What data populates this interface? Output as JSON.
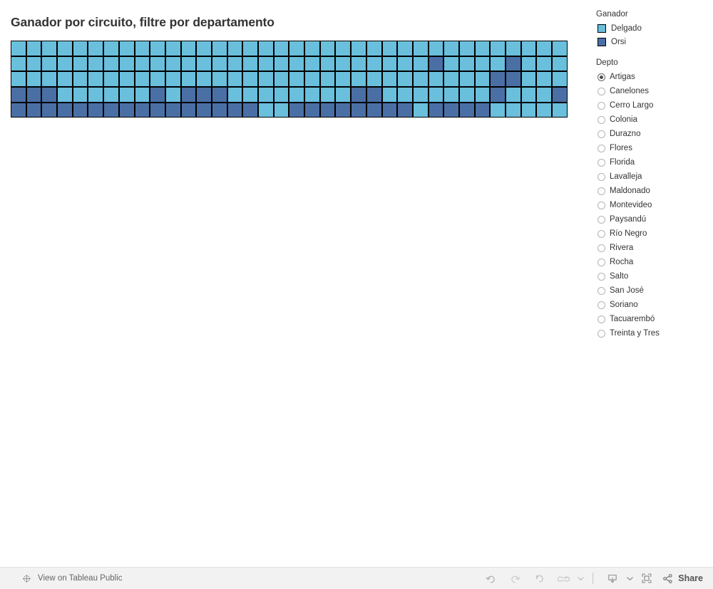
{
  "dashboard": {
    "title": "Ganador por circuito, filtre por departamento"
  },
  "legend": {
    "heading": "Ganador",
    "items": [
      {
        "label": "Delgado",
        "color": "#69bfdc"
      },
      {
        "label": "Orsi",
        "color": "#4a6fa5"
      }
    ]
  },
  "filter": {
    "heading": "Depto",
    "selected": "Artigas",
    "options": [
      "Artigas",
      "Canelones",
      "Cerro Largo",
      "Colonia",
      "Durazno",
      "Flores",
      "Florida",
      "Lavalleja",
      "Maldonado",
      "Montevideo",
      "Paysandú",
      "Río Negro",
      "Rivera",
      "Rocha",
      "Salto",
      "San José",
      "Soriano",
      "Tacuarembó",
      "Treinta y Tres"
    ]
  },
  "toolbar": {
    "tableau_public_label": "View on Tableau Public",
    "tableau_icon": "tableau-sparkle-icon",
    "share_label": "Share",
    "buttons": [
      {
        "name": "undo-button",
        "icon": "undo-icon"
      },
      {
        "name": "redo-button",
        "icon": "redo-icon"
      },
      {
        "name": "revert-button",
        "icon": "revert-icon"
      },
      {
        "name": "refresh-button",
        "icon": "refresh-icon"
      },
      {
        "name": "refresh-dropdown",
        "icon": "chevron-down-icon"
      },
      {
        "name": "download-button",
        "icon": "download-icon"
      },
      {
        "name": "download-dropdown",
        "icon": "chevron-down-icon"
      },
      {
        "name": "fullscreen-button",
        "icon": "fullscreen-icon"
      },
      {
        "name": "share-button",
        "icon": "share-icon"
      }
    ]
  },
  "chart_data": {
    "type": "heatmap",
    "title": "Ganador por circuito, filtre por departamento",
    "xlabel": "",
    "ylabel": "",
    "grid": true,
    "legend_position": "right",
    "categories": [
      "Delgado",
      "Orsi"
    ],
    "category_colors": {
      "Delgado": "#69bfdc",
      "Orsi": "#4a6fa5"
    },
    "columns": 36,
    "rows": 5,
    "description": "Grid of circuit squares colored by winning candidate for the selected department (Artigas).",
    "cells": [
      [
        "D",
        "D",
        "D",
        "D",
        "D",
        "D",
        "D",
        "D",
        "D",
        "D",
        "D",
        "D",
        "D",
        "D",
        "D",
        "D",
        "D",
        "D",
        "D",
        "D",
        "D",
        "D",
        "D",
        "D",
        "D",
        "D",
        "D",
        "D",
        "D",
        "D",
        "D",
        "D",
        "D",
        "D",
        "D",
        "D"
      ],
      [
        "D",
        "D",
        "D",
        "D",
        "D",
        "D",
        "D",
        "D",
        "D",
        "D",
        "D",
        "D",
        "D",
        "D",
        "D",
        "D",
        "D",
        "D",
        "D",
        "D",
        "D",
        "D",
        "D",
        "D",
        "D",
        "D",
        "D",
        "O",
        "D",
        "D",
        "D",
        "D",
        "O",
        "D",
        "D",
        "D"
      ],
      [
        "D",
        "D",
        "D",
        "D",
        "D",
        "D",
        "D",
        "D",
        "D",
        "D",
        "D",
        "D",
        "D",
        "D",
        "D",
        "D",
        "D",
        "D",
        "D",
        "D",
        "D",
        "D",
        "D",
        "D",
        "D",
        "D",
        "D",
        "D",
        "D",
        "D",
        "D",
        "O",
        "O",
        "D",
        "D",
        "D"
      ],
      [
        "O",
        "O",
        "O",
        "D",
        "D",
        "D",
        "D",
        "D",
        "D",
        "O",
        "D",
        "O",
        "O",
        "O",
        "D",
        "D",
        "D",
        "D",
        "D",
        "D",
        "D",
        "D",
        "O",
        "O",
        "D",
        "D",
        "D",
        "D",
        "D",
        "D",
        "D",
        "O",
        "D",
        "D",
        "D",
        "O"
      ],
      [
        "O",
        "O",
        "O",
        "O",
        "O",
        "O",
        "O",
        "O",
        "O",
        "O",
        "O",
        "O",
        "O",
        "O",
        "O",
        "O",
        "D",
        "D",
        "O",
        "O",
        "O",
        "O",
        "O",
        "O",
        "O",
        "O",
        "D",
        "O",
        "O",
        "O",
        "O",
        "D",
        "D",
        "D",
        "D",
        "D"
      ]
    ],
    "counts": {
      "Delgado": 140,
      "Orsi": 40
    }
  }
}
